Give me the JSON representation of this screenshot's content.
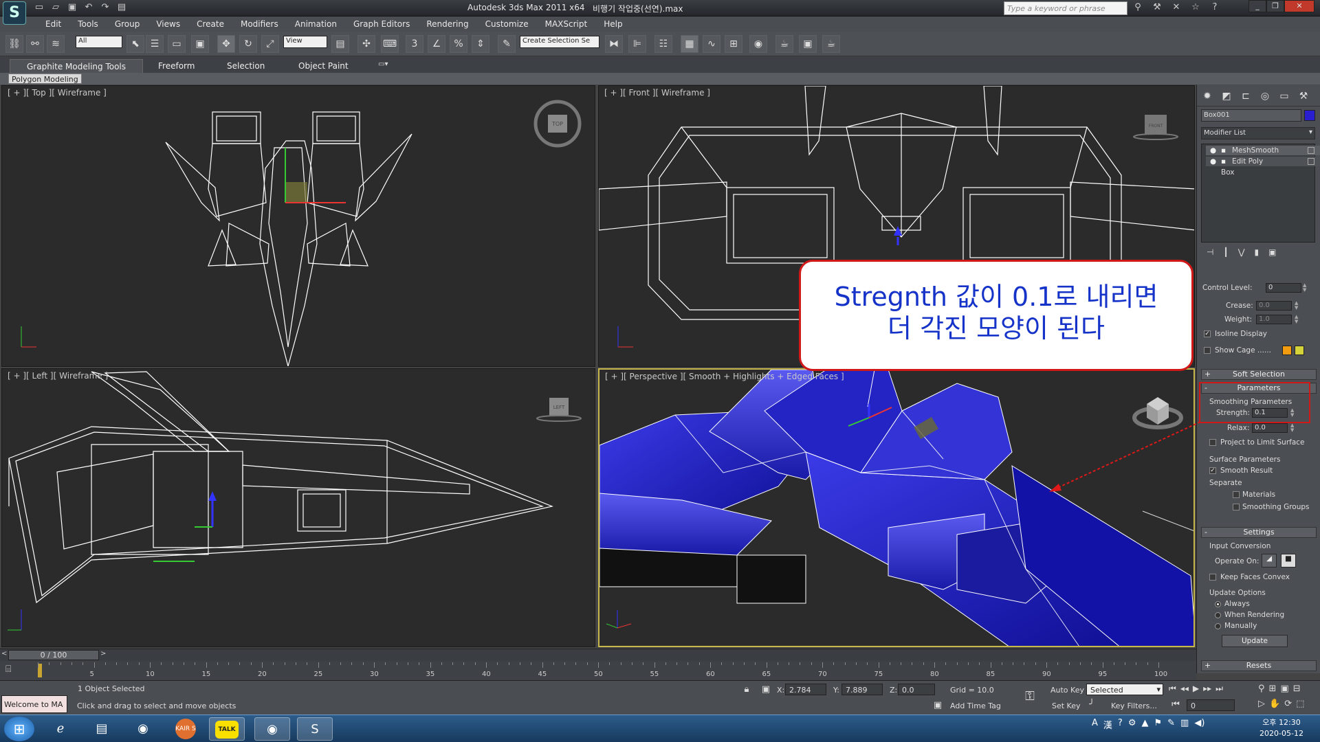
{
  "app": {
    "logo": "S",
    "title": "Autodesk 3ds Max  2011 x64",
    "file": "비행기 작업중(선연).max",
    "search_placeholder": "Type a keyword or phrase",
    "window_controls": [
      "_",
      "❐",
      "✕"
    ]
  },
  "menu": [
    "Edit",
    "Tools",
    "Group",
    "Views",
    "Create",
    "Modifiers",
    "Animation",
    "Graph Editors",
    "Rendering",
    "Customize",
    "MAXScript",
    "Help"
  ],
  "toolbar": {
    "selection_filter": "All",
    "ref_coord": "View",
    "named_selection": "Create Selection Se"
  },
  "ribbon": {
    "tabs": [
      "Graphite Modeling Tools",
      "Freeform",
      "Selection",
      "Object Paint"
    ],
    "sub_label": "Polygon Modeling"
  },
  "viewports": {
    "top": "[ + ][ Top ][ Wireframe ]",
    "front": "[ + ][ Front ][ Wireframe ]",
    "left": "[ + ][ Left ][ Wireframe ]",
    "perspective": "[ + ][ Perspective ][ Smooth + Highlights + Edged Faces ]",
    "viewcube": {
      "top": "TOP",
      "front": "FRONT",
      "left": "LEFT"
    }
  },
  "callout": {
    "line1": "Stregnth 값이 0.1로 내리면",
    "line2": "더 각진 모양이 된다"
  },
  "command_panel": {
    "object_name": "Box001",
    "object_color": "#2a1fd0",
    "modifier_list": "Modifier List",
    "stack": [
      "MeshSmooth",
      "Edit Poly",
      "Box"
    ],
    "control_level_label": "Control Level:",
    "control_level": "0",
    "crease_label": "Crease:",
    "crease": "0.0",
    "weight_label": "Weight:",
    "weight": "1.0",
    "isoline_display": "Isoline Display",
    "show_cage": "Show Cage ......",
    "soft_selection": "Soft Selection",
    "parameters": "Parameters",
    "smoothing_parameters": "Smoothing Parameters",
    "strength_label": "Strength:",
    "strength": "0.1",
    "relax_label": "Relax:",
    "relax": "0.0",
    "project_limit": "Project to Limit Surface",
    "surface_parameters": "Surface Parameters",
    "smooth_result": "Smooth Result",
    "separate": "Separate",
    "materials": "Materials",
    "smoothing_groups": "Smoothing Groups",
    "settings": "Settings",
    "input_conversion": "Input Conversion",
    "operate_on": "Operate On:",
    "keep_faces_convex": "Keep Faces Convex",
    "update_options": "Update Options",
    "always": "Always",
    "when_rendering": "When Rendering",
    "manually": "Manually",
    "update_btn": "Update",
    "resets": "Resets",
    "cage_colors": [
      "#f39c12",
      "#d4d43a"
    ]
  },
  "timeline": {
    "frame": "0 / 100",
    "ticks": [
      5,
      10,
      15,
      20,
      25,
      30,
      35,
      40,
      45,
      50,
      55,
      60,
      65,
      70,
      75,
      80,
      85,
      90,
      95,
      100
    ]
  },
  "status": {
    "welcome": "Welcome to MA",
    "selected": "1 Object Selected",
    "prompt": "Click and drag to select and move objects",
    "x_label": "X:",
    "x": "2.784",
    "y_label": "Y:",
    "y": "7.889",
    "z_label": "Z:",
    "z": "0.0",
    "grid": "Grid = 10.0",
    "add_time_tag": "Add Time Tag",
    "auto_key": "Auto Key",
    "set_key": "Set Key",
    "key_mode": "Selected",
    "key_filters": "Key Filters...",
    "frame_field": "0"
  },
  "taskbar": {
    "apps": [
      "ie-icon",
      "explorer-icon",
      "chrome-icon",
      "kairos-icon",
      "kakaotalk-icon",
      "chrome-alt-icon",
      "3dsmax-icon"
    ],
    "kairos_label": "KAIR S",
    "talk_label": "TALK",
    "time": "오후 12:30",
    "date": "2020-05-12"
  }
}
